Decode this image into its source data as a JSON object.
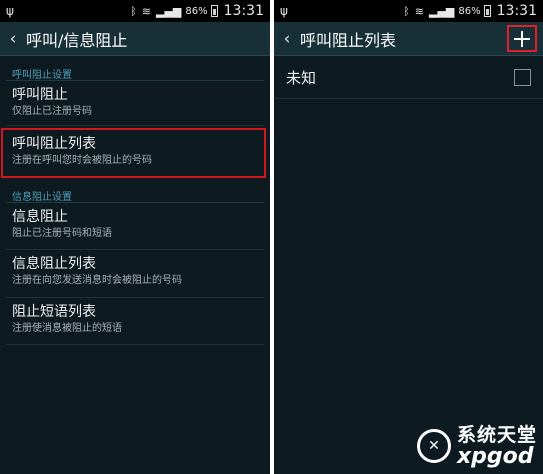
{
  "status_bar": {
    "usb_icon": "usb-icon",
    "battery_percent": "86%",
    "time": "13:31"
  },
  "left": {
    "title": "呼叫/信息阻止",
    "sections": [
      {
        "header": "呼叫阻止设置",
        "items": [
          {
            "title": "呼叫阻止",
            "subtitle": "仅阻止已注册号码"
          },
          {
            "title": "呼叫阻止列表",
            "subtitle": "注册在呼叫您时会被阻止的号码"
          }
        ]
      },
      {
        "header": "信息阻止设置",
        "items": [
          {
            "title": "信息阻止",
            "subtitle": "阻止已注册号码和短语"
          },
          {
            "title": "信息阻止列表",
            "subtitle": "注册在向您发送消息时会被阻止的号码"
          },
          {
            "title": "阻止短语列表",
            "subtitle": "注册使消息被阻止的短语"
          }
        ]
      }
    ],
    "highlight_color": "#d11820"
  },
  "right": {
    "title": "呼叫阻止列表",
    "add_icon": "plus-icon",
    "list": [
      {
        "name": "未知",
        "checked": false
      }
    ]
  },
  "watermark": {
    "cn": "系统天堂",
    "en": "xpgod"
  },
  "colors": {
    "background": "#0d1a20",
    "action_bar": "#173038",
    "section_header": "#4f9fb8",
    "highlight": "#e0202a"
  }
}
